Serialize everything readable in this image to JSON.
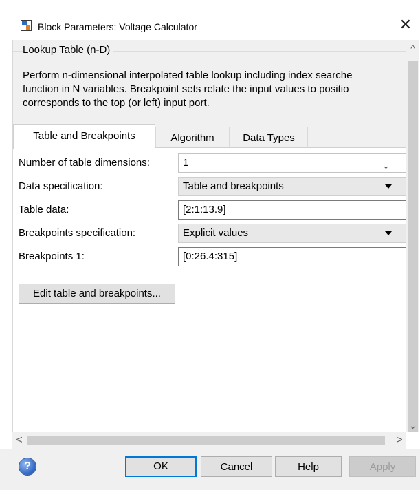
{
  "window": {
    "title": "Block Parameters: Voltage Calculator",
    "close_glyph": "✕",
    "icon": "simulink-block-icon"
  },
  "block": {
    "group_title": "Lookup Table (n-D)",
    "description_lines": [
      "Perform n-dimensional interpolated table lookup including index searche",
      "function in N variables. Breakpoint sets relate the input values to positio",
      "corresponds to the top (or left) input port."
    ]
  },
  "tabs": [
    {
      "label": "Table and Breakpoints",
      "active": true
    },
    {
      "label": "Algorithm",
      "active": false
    },
    {
      "label": "Data Types",
      "active": false
    }
  ],
  "fields": {
    "num_dims": {
      "label": "Number of table dimensions:",
      "value": "1"
    },
    "data_spec": {
      "label": "Data specification:",
      "value": "Table and breakpoints"
    },
    "table_data": {
      "label": "Table data:",
      "value": "[2:1:13.9]"
    },
    "bp_spec": {
      "label": "Breakpoints specification:",
      "value": "Explicit values"
    },
    "bp1": {
      "label": "Breakpoints 1:",
      "value": "[0:26.4:315]"
    }
  },
  "edit_button_label": "Edit table and breakpoints...",
  "scrollbars": {
    "up_glyph": "^",
    "down_glyph": "⌄",
    "left_glyph": "<",
    "right_glyph": ">"
  },
  "footer": {
    "help_glyph": "?",
    "ok": "OK",
    "cancel": "Cancel",
    "help": "Help",
    "apply": "Apply"
  },
  "colors": {
    "default_button_border": "#0078d7",
    "panel_bg": "#f0f0f0",
    "disabled_text": "#9c9c9c"
  }
}
